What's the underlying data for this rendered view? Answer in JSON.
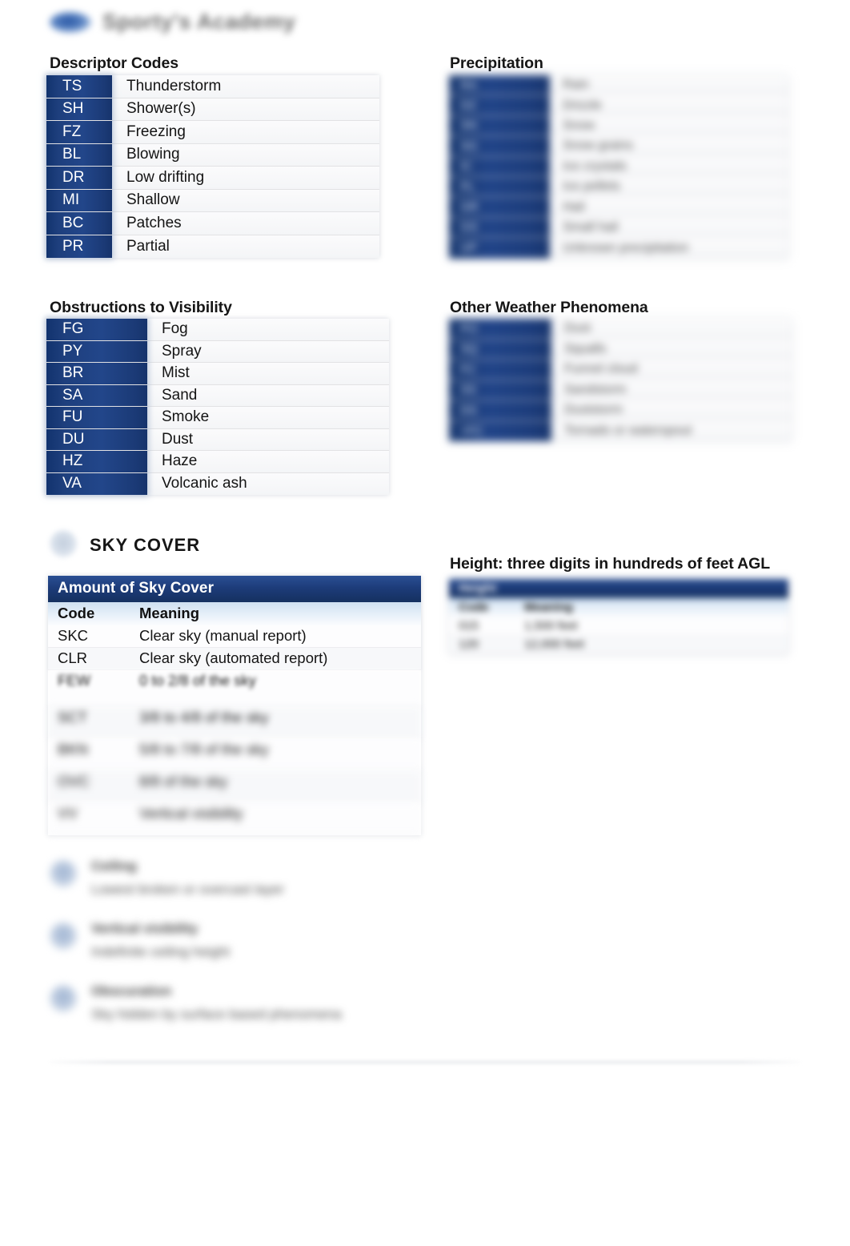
{
  "document": {
    "logo_text": "Sporty's Academy",
    "footer_note": ""
  },
  "sections": {
    "descriptor": {
      "heading": "Descriptor Codes",
      "rows": [
        {
          "code": "TS",
          "meaning": "Thunderstorm"
        },
        {
          "code": "SH",
          "meaning": "Shower(s)"
        },
        {
          "code": "FZ",
          "meaning": "Freezing"
        },
        {
          "code": "BL",
          "meaning": "Blowing"
        },
        {
          "code": "DR",
          "meaning": "Low drifting"
        },
        {
          "code": "MI",
          "meaning": "Shallow"
        },
        {
          "code": "BC",
          "meaning": "Patches"
        },
        {
          "code": "PR",
          "meaning": "Partial"
        }
      ]
    },
    "precipitation": {
      "heading": "Precipitation",
      "rows": [
        {
          "code": "RA",
          "meaning": "Rain"
        },
        {
          "code": "DZ",
          "meaning": "Drizzle"
        },
        {
          "code": "SN",
          "meaning": "Snow"
        },
        {
          "code": "SG",
          "meaning": "Snow grains"
        },
        {
          "code": "IC",
          "meaning": "Ice crystals"
        },
        {
          "code": "PL",
          "meaning": "Ice pellets"
        },
        {
          "code": "GR",
          "meaning": "Hail"
        },
        {
          "code": "GS",
          "meaning": "Small hail"
        },
        {
          "code": "UP",
          "meaning": "Unknown precipitation"
        }
      ]
    },
    "obstructions": {
      "heading": "Obstructions to Visibility",
      "rows": [
        {
          "code": "FG",
          "meaning": "Fog"
        },
        {
          "code": "PY",
          "meaning": "Spray"
        },
        {
          "code": "BR",
          "meaning": "Mist"
        },
        {
          "code": "SA",
          "meaning": "Sand"
        },
        {
          "code": "FU",
          "meaning": "Smoke"
        },
        {
          "code": "DU",
          "meaning": "Dust"
        },
        {
          "code": "HZ",
          "meaning": "Haze"
        },
        {
          "code": "VA",
          "meaning": "Volcanic ash"
        }
      ]
    },
    "other_phenomena": {
      "heading": "Other Weather Phenomena",
      "rows": [
        {
          "code": "PO",
          "meaning": "Dust"
        },
        {
          "code": "SQ",
          "meaning": "Squalls"
        },
        {
          "code": "FC",
          "meaning": "Funnel cloud"
        },
        {
          "code": "SS",
          "meaning": "Sandstorm"
        },
        {
          "code": "DS",
          "meaning": "Duststorm"
        },
        {
          "code": "+FC",
          "meaning": "Tornado or waterspout"
        }
      ]
    },
    "sky_cover": {
      "icon": "sun-cloud-icon",
      "heading": "SKY COVER",
      "table_title": "Amount of Sky Cover",
      "col_headers": {
        "code": "Code",
        "meaning": "Meaning"
      },
      "rows": [
        {
          "code": "SKC",
          "meaning": "Clear sky (manual report)"
        },
        {
          "code": "CLR",
          "meaning": "Clear sky (automated report)"
        },
        {
          "code": "FEW",
          "meaning": "0 to 2/8 of the sky"
        },
        {
          "code": "SCT",
          "meaning": "3/8 to 4/8 of the sky"
        },
        {
          "code": "BKN",
          "meaning": "5/8 to 7/8 of the sky"
        },
        {
          "code": "OVC",
          "meaning": "8/8 of the sky"
        },
        {
          "code": "VV",
          "meaning": "Vertical visibility"
        }
      ]
    },
    "height": {
      "heading": "Height: three digits in hundreds of feet AGL",
      "table_title": "Height",
      "col_headers": {
        "code": "Code",
        "meaning": "Meaning"
      },
      "rows": [
        {
          "code": "015",
          "meaning": "1,500 feet"
        },
        {
          "code": "120",
          "meaning": "12,000 feet"
        }
      ]
    }
  },
  "notes": [
    {
      "icon": "info-circle-icon",
      "title": "Ceiling",
      "text": "Lowest broken or overcast layer"
    },
    {
      "icon": "info-circle-icon",
      "title": "Vertical visibility",
      "text": "Indefinite ceiling height"
    },
    {
      "icon": "info-circle-icon",
      "title": "Obscuration",
      "text": "Sky hidden by surface based phenomena"
    }
  ],
  "colors": {
    "code_blue": "#1d3e80",
    "banner_blue": "#1d3c7a",
    "subhead_blue": "#cfe0f1",
    "text": "#141414"
  }
}
